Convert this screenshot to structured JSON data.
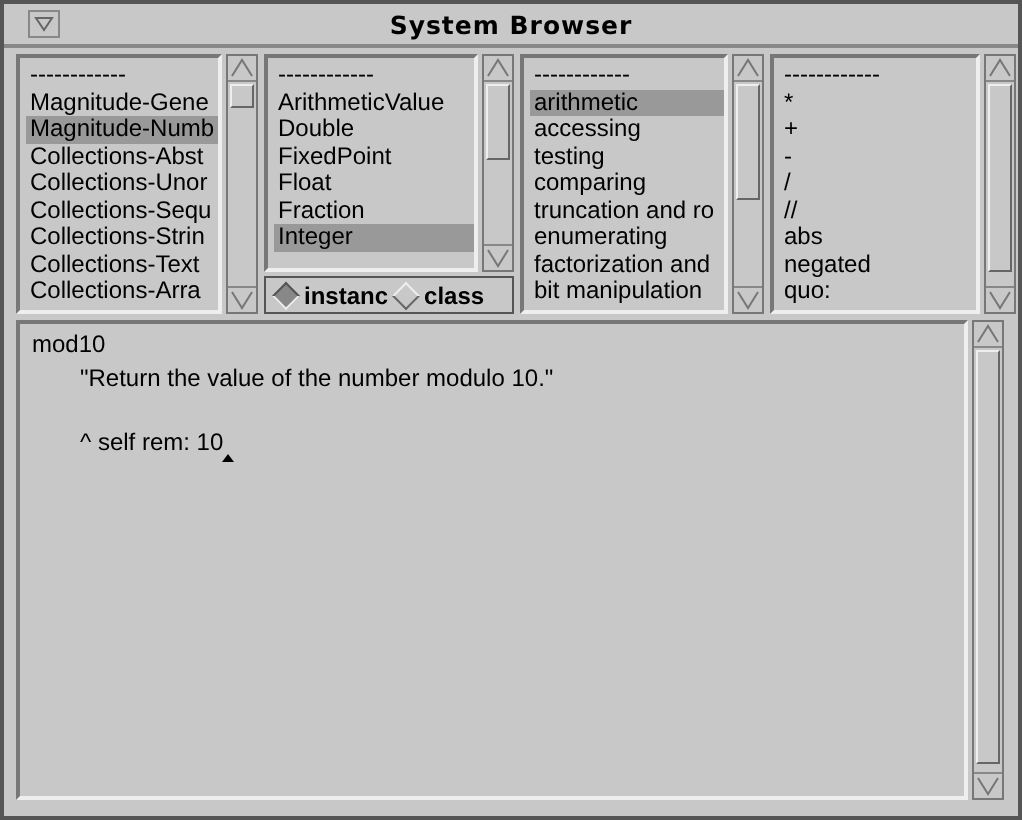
{
  "window": {
    "title": "System Browser"
  },
  "panes": [
    {
      "items": [
        {
          "label": "------------",
          "selected": false
        },
        {
          "label": "Magnitude-Gene",
          "selected": false
        },
        {
          "label": "Magnitude-Numb",
          "selected": true
        },
        {
          "label": "Collections-Abst",
          "selected": false
        },
        {
          "label": "Collections-Unor",
          "selected": false
        },
        {
          "label": "Collections-Sequ",
          "selected": false
        },
        {
          "label": "Collections-Strin",
          "selected": false
        },
        {
          "label": "Collections-Text",
          "selected": false
        },
        {
          "label": "Collections-Arra",
          "selected": false
        }
      ]
    },
    {
      "items": [
        {
          "label": "------------",
          "selected": false
        },
        {
          "label": "ArithmeticValue",
          "selected": false
        },
        {
          "label": "Double",
          "selected": false
        },
        {
          "label": "FixedPoint",
          "selected": false
        },
        {
          "label": "Float",
          "selected": false
        },
        {
          "label": "Fraction",
          "selected": false
        },
        {
          "label": "Integer",
          "selected": true
        }
      ]
    },
    {
      "items": [
        {
          "label": "------------",
          "selected": false
        },
        {
          "label": "arithmetic",
          "selected": true
        },
        {
          "label": "accessing",
          "selected": false
        },
        {
          "label": "testing",
          "selected": false
        },
        {
          "label": "comparing",
          "selected": false
        },
        {
          "label": "truncation and ro",
          "selected": false
        },
        {
          "label": "enumerating",
          "selected": false
        },
        {
          "label": "factorization and",
          "selected": false
        },
        {
          "label": "bit manipulation",
          "selected": false
        }
      ]
    },
    {
      "items": [
        {
          "label": "------------",
          "selected": false
        },
        {
          "label": "*",
          "selected": false
        },
        {
          "label": "+",
          "selected": false
        },
        {
          "label": "-",
          "selected": false
        },
        {
          "label": "/",
          "selected": false
        },
        {
          "label": "//",
          "selected": false
        },
        {
          "label": "abs",
          "selected": false
        },
        {
          "label": "negated",
          "selected": false
        },
        {
          "label": "quo:",
          "selected": false
        }
      ]
    }
  ],
  "view_toggle": [
    {
      "label": "instanc",
      "selected": true
    },
    {
      "label": "class",
      "selected": false
    }
  ],
  "editor": {
    "lines": [
      {
        "kind": "selector",
        "text": "mod10"
      },
      {
        "kind": "comment",
        "text": "\"Return the value of the number modulo 10.\""
      },
      {
        "kind": "statement",
        "text": "^ self rem: 10"
      }
    ]
  }
}
